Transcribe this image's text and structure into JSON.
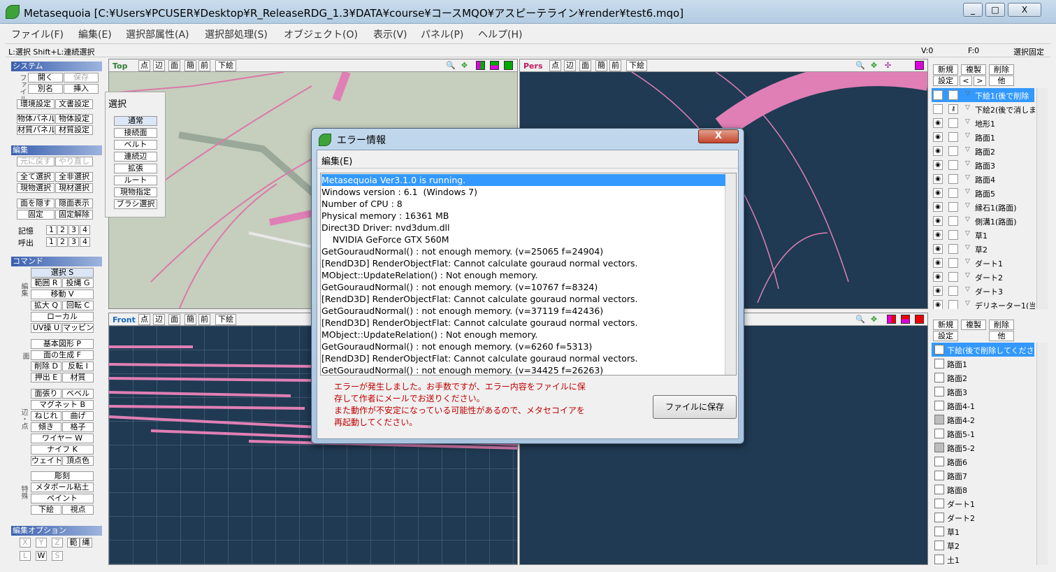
{
  "window": {
    "title": "Metasequoia [C:¥Users¥PCUSER¥Desktop¥R_ReleaseRDG_1.3¥DATA¥course¥コースMQO¥アスピーテライン¥render¥test6.mqo]",
    "minimize": "_",
    "maximize": "□",
    "close": "X"
  },
  "menubar": [
    "ファイル(F)",
    "編集(E)",
    "選択部属性(A)",
    "選択部処理(S)",
    "オブジェクト(O)",
    "表示(V)",
    "パネル(P)",
    "ヘルプ(H)"
  ],
  "status": {
    "hint": "L:選択  Shift+L:連続選択",
    "vertex": "V:0",
    "face": "F:0",
    "lock": "選択固定"
  },
  "left_panel": {
    "system_title": "システム",
    "file_label": "ファイル",
    "open": "開く",
    "save": "保存",
    "save_as": "別名",
    "insert": "挿入",
    "env_settings": "環境設定",
    "doc_settings": "文書設定",
    "obj_panel": "物体パネル",
    "obj_settings": "物体設定",
    "mat_panel": "材質パネル",
    "mat_settings": "材質設定",
    "edit_title": "編集",
    "undo": "元に戻す",
    "redo": "やり直し",
    "select_all": "全て選択",
    "deselect_all": "全非選択",
    "cur_obj_select": "現物選択",
    "cur_mat_select": "現材選択",
    "hide_face": "面を隠す",
    "show_hidden": "隠面表示",
    "fix": "固定",
    "unfix": "固定解除",
    "memory": "記憶",
    "recall": "呼出",
    "slots": [
      "1",
      "2",
      "3",
      "4"
    ],
    "command_title": "コマンド",
    "edit_label": "編集",
    "select": "選択 S",
    "range": "範囲 R",
    "lasso": "投縄 G",
    "move": "移動 V",
    "scale": "拡大 Q",
    "rotate": "回転 C",
    "local": "ローカル",
    "uv": "UV操 U",
    "mapping": "マッピング",
    "face_label": "面",
    "basic_shape": "基本図形 P",
    "face_create": "面の生成 F",
    "delete": "削除 D",
    "invert": "反転 I",
    "extrude": "押出 E",
    "material": "材質",
    "edge_label": "辺・点",
    "stretch": "面張り",
    "bevel": "ベベル",
    "magnet": "マグネット B",
    "twist": "ねじれ",
    "bend": "曲げ",
    "tilt": "傾き",
    "lattice": "格子",
    "wire": "ワイヤー W",
    "knife": "ナイフ K",
    "weight": "ウェイト",
    "vcolor": "頂点色",
    "special_label": "特殊",
    "sculpt": "彫刻",
    "metaball": "メタボール粘土",
    "paint": "ペイント",
    "underlay": "下絵",
    "viewpoint": "視点",
    "edit_option_title": "編集オプション",
    "axis": [
      "X",
      "Y",
      "Z"
    ],
    "range_opt": "範",
    "lasso_opt": "縄",
    "l_btn": "L",
    "w_btn": "W",
    "s_btn": "S"
  },
  "select_panel": {
    "title": "選択",
    "items": [
      "通常",
      "接続面",
      "ベルト",
      "連続辺",
      "拡張",
      "ルート",
      "現物指定",
      "ブラシ選択"
    ]
  },
  "viewports": {
    "top_name": "Top",
    "front_name": "Front",
    "pers_name": "Pers",
    "btn_point": "点",
    "btn_edge": "辺",
    "btn_face": "面",
    "btn_simple": "簡",
    "btn_front": "前",
    "btn_underlay": "下絵",
    "zoom_icon": "🔍",
    "move_icon": "✥",
    "rotate_icon": "✣"
  },
  "objects_panel": {
    "new": "新規",
    "copy": "複製",
    "delete": "削除",
    "settings": "設定",
    "prev": "<",
    "next": ">",
    "other": "他",
    "items": [
      "下絵1(後で削除",
      "下絵2(後で消しま",
      "地形1",
      "路面1",
      "路面2",
      "路面3",
      "路面4",
      "路面5",
      "縁石1(路面)",
      "側溝1(路面)",
      "草1",
      "草2",
      "ダート1",
      "ダート2",
      "ダート3",
      "デリネーター1(当た"
    ]
  },
  "materials_panel": {
    "new": "新規",
    "copy": "複製",
    "delete": "削除",
    "settings": "設定",
    "other": "他",
    "items": [
      "下絵(後で削除してくださ",
      "路面1",
      "路面2",
      "路面3",
      "路面4-1",
      "路面4-2",
      "路面5-1",
      "路面5-2",
      "路面6",
      "路面7",
      "路面8",
      "ダート1",
      "ダート2",
      "草1",
      "草2",
      "土1"
    ]
  },
  "dialog": {
    "title": "エラー情報",
    "close": "X",
    "menu": "編集(E)",
    "log": [
      "Metasequoia Ver3.1.0 is running.",
      "Windows version : 6.1  (Windows 7)",
      "Number of CPU : 8",
      "Physical memory : 16361 MB",
      "Direct3D Driver: nvd3dum.dll",
      "    NVIDIA GeForce GTX 560M",
      "GetGouraudNormal() : not enough memory. (v=25065 f=24904)",
      "[RendD3D] RenderObjectFlat: Cannot calculate gouraud normal vectors.",
      "MObject::UpdateRelation() : Not enough memory.",
      "GetGouraudNormal() : not enough memory. (v=10767 f=8324)",
      "[RendD3D] RenderObjectFlat: Cannot calculate gouraud normal vectors.",
      "GetGouraudNormal() : not enough memory. (v=37119 f=42436)",
      "[RendD3D] RenderObjectFlat: Cannot calculate gouraud normal vectors.",
      "MObject::UpdateRelation() : Not enough memory.",
      "GetGouraudNormal() : not enough memory. (v=6260 f=5313)",
      "[RendD3D] RenderObjectFlat: Cannot calculate gouraud normal vectors.",
      "GetGouraudNormal() : not enough memory. (v=34425 f=26263)"
    ],
    "message": [
      "エラーが発生しました。お手数ですが、エラー内容をファイルに保",
      "存して作者にメールでお送りください。",
      "また動作が不安定になっている可能性があるので、メタセコイアを",
      "再起動してください。"
    ],
    "save_button": "ファイルに保存"
  },
  "colors": {
    "viewport_bg": "#1f3a52",
    "path_pink": "#e07fb5",
    "accent_blue": "#3399ff",
    "error_red": "#c00000"
  }
}
